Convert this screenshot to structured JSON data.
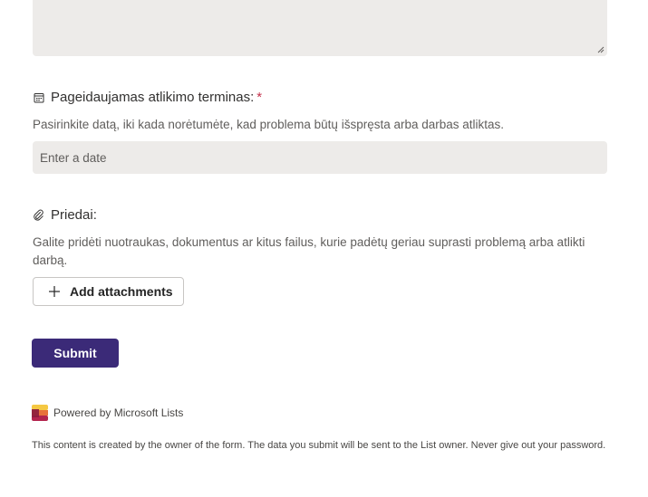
{
  "due_date_question": {
    "title": "Pageidaujamas atlikimo terminas:",
    "required_mark": "*",
    "description": "Pasirinkite datą, iki kada norėtumėte, kad problema būtų išspręsta arba darbas atliktas.",
    "input_placeholder": "Enter a date",
    "icon": "calendar-icon"
  },
  "attachments_question": {
    "title": "Priedai:",
    "description": "Galite pridėti nuotraukas, dokumentus ar kitus failus, kurie padėtų geriau suprasti problemą arba atlikti darbą.",
    "button_label": "Add attachments",
    "icon": "paperclip-icon"
  },
  "submit": {
    "label": "Submit",
    "color": "#3b2a78"
  },
  "footer": {
    "powered_by": "Powered by Microsoft Lists",
    "disclaimer": "This content is created by the owner of the form. The data you submit will be sent to the List owner. Never give out your password."
  },
  "colors": {
    "field_background": "#edebe9",
    "required": "#c4314b"
  }
}
